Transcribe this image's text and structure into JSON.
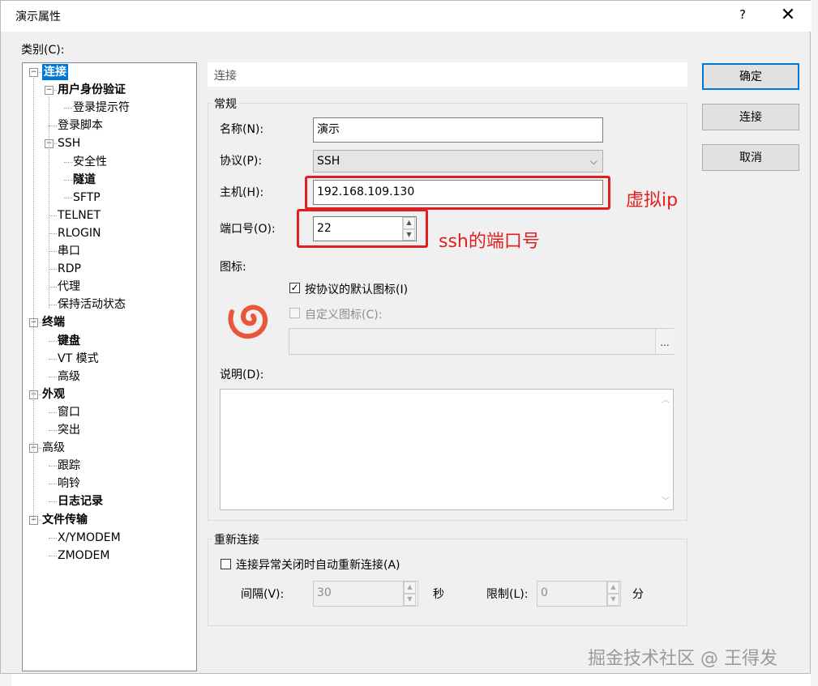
{
  "window": {
    "title": "演示属性",
    "help": "?",
    "close": "✕"
  },
  "category_label": "类别(C):",
  "tree": [
    {
      "label": "连接",
      "level": 0,
      "bold": true,
      "selected": true,
      "expander": "−"
    },
    {
      "label": "用户身份验证",
      "level": 1,
      "bold": true,
      "expander": "−"
    },
    {
      "label": "登录提示符",
      "level": 2
    },
    {
      "label": "登录脚本",
      "level": 1
    },
    {
      "label": "SSH",
      "level": 1,
      "expander": "−"
    },
    {
      "label": "安全性",
      "level": 2
    },
    {
      "label": "隧道",
      "level": 2,
      "bold": true
    },
    {
      "label": "SFTP",
      "level": 2
    },
    {
      "label": "TELNET",
      "level": 1
    },
    {
      "label": "RLOGIN",
      "level": 1
    },
    {
      "label": "串口",
      "level": 1
    },
    {
      "label": "RDP",
      "level": 1
    },
    {
      "label": "代理",
      "level": 1
    },
    {
      "label": "保持活动状态",
      "level": 1
    },
    {
      "label": "终端",
      "level": 0,
      "bold": true,
      "expander": "−"
    },
    {
      "label": "键盘",
      "level": 1,
      "bold": true
    },
    {
      "label": "VT 模式",
      "level": 1
    },
    {
      "label": "高级",
      "level": 1
    },
    {
      "label": "外观",
      "level": 0,
      "bold": true,
      "expander": "−"
    },
    {
      "label": "窗口",
      "level": 1
    },
    {
      "label": "突出",
      "level": 1
    },
    {
      "label": "高级",
      "level": 0,
      "expander": "−"
    },
    {
      "label": "跟踪",
      "level": 1
    },
    {
      "label": "响铃",
      "level": 1
    },
    {
      "label": "日志记录",
      "level": 1,
      "bold": true
    },
    {
      "label": "文件传输",
      "level": 0,
      "bold": true,
      "expander": "−"
    },
    {
      "label": "X/YMODEM",
      "level": 1
    },
    {
      "label": "ZMODEM",
      "level": 1
    }
  ],
  "panel_header": "连接",
  "general": {
    "title": "常规",
    "name_label": "名称(N):",
    "name_value": "演示",
    "protocol_label": "协议(P):",
    "protocol_value": "SSH",
    "host_label": "主机(H):",
    "host_value": "192.168.109.130",
    "port_label": "端口号(O):",
    "port_value": "22",
    "icon_label": "图标:",
    "default_icon_label": "按协议的默认图标(I)",
    "default_icon_checked": true,
    "custom_icon_label": "自定义图标(C):",
    "browse": "...",
    "desc_label": "说明(D):"
  },
  "reconnect": {
    "title": "重新连接",
    "auto_label": "连接异常关闭时自动重新连接(A)",
    "interval_label": "间隔(V):",
    "interval_value": "30",
    "interval_unit": "秒",
    "limit_label": "限制(L):",
    "limit_value": "0",
    "limit_unit": "分"
  },
  "buttons": {
    "ok": "确定",
    "connect": "连接",
    "cancel": "取消"
  },
  "annotations": {
    "host": "虚拟ip",
    "port": "ssh的端口号"
  },
  "watermark": "掘金技术社区 @ 王得发"
}
